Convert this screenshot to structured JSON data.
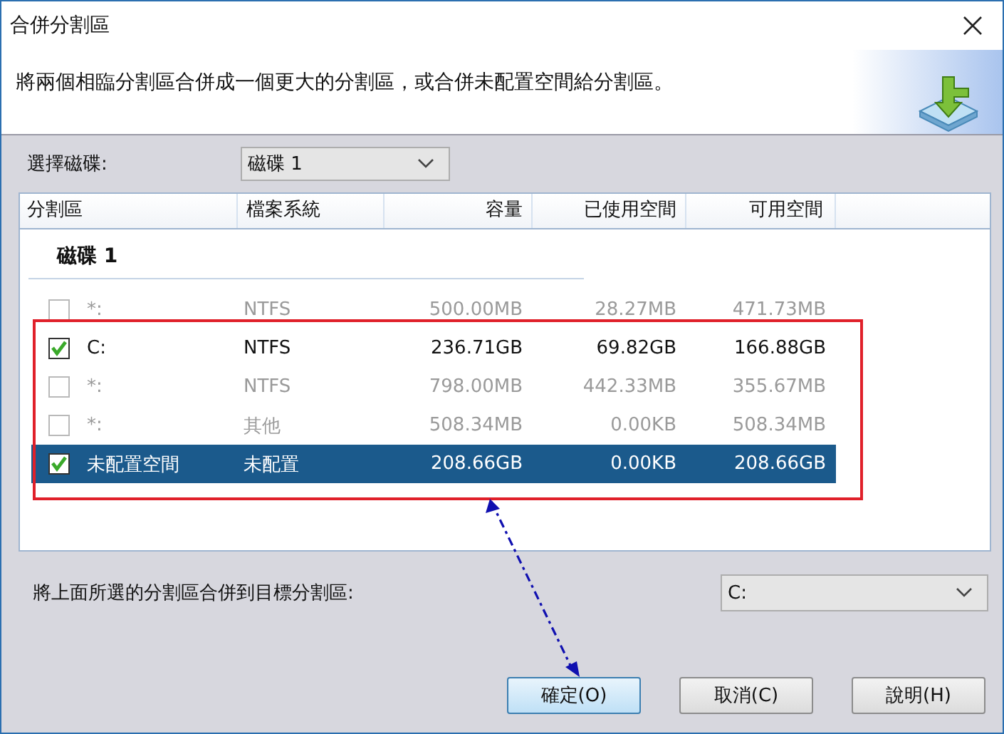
{
  "window": {
    "title": "合併分割區"
  },
  "description": "將兩個相臨分割區合併成一個更大的分割區，或合併未配置空間給分割區。",
  "disk_select": {
    "label": "選擇磁碟:",
    "value": "磁碟 1"
  },
  "table": {
    "columns": [
      "分割區",
      "檔案系統",
      "容量",
      "已使用空間",
      "可用空間"
    ],
    "group": "磁碟 1",
    "rows": [
      {
        "partition": "*:",
        "file_system": "NTFS",
        "capacity": "500.00MB",
        "used": "28.27MB",
        "free": "471.73MB",
        "checked": false,
        "disabled": true,
        "selected": false
      },
      {
        "partition": "C:",
        "file_system": "NTFS",
        "capacity": "236.71GB",
        "used": "69.82GB",
        "free": "166.88GB",
        "checked": true,
        "disabled": false,
        "selected": false
      },
      {
        "partition": "*:",
        "file_system": "NTFS",
        "capacity": "798.00MB",
        "used": "442.33MB",
        "free": "355.67MB",
        "checked": false,
        "disabled": true,
        "selected": false
      },
      {
        "partition": "*:",
        "file_system": "其他",
        "capacity": "508.34MB",
        "used": "0.00KB",
        "free": "508.34MB",
        "checked": false,
        "disabled": true,
        "selected": false
      },
      {
        "partition": "未配置空間",
        "file_system": "未配置",
        "capacity": "208.66GB",
        "used": "0.00KB",
        "free": "208.66GB",
        "checked": true,
        "disabled": false,
        "selected": true
      }
    ]
  },
  "target": {
    "label": "將上面所選的分割區合併到目標分割區:",
    "value": "C:"
  },
  "buttons": [
    {
      "label": "確定(O)",
      "default": true
    },
    {
      "label": "取消(C)",
      "default": false
    },
    {
      "label": "說明(H)",
      "default": false
    }
  ]
}
